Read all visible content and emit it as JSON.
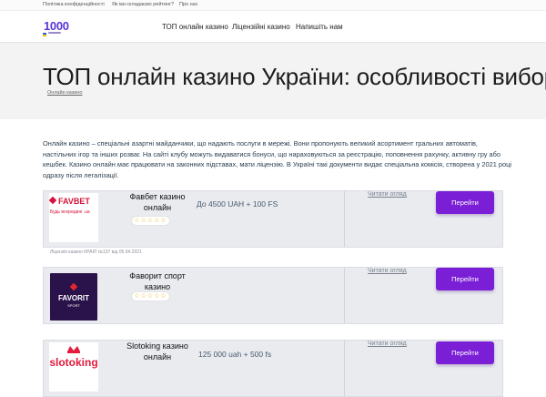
{
  "topbar": {
    "links": [
      "Політика конфіденційності",
      "Як ми складаємо рейтинг?",
      "Про нас"
    ]
  },
  "header": {
    "logo_text": "1000",
    "nav": [
      "ТОП онлайн казино",
      "Ліцензійні казино",
      "Напишіть нам"
    ]
  },
  "hero": {
    "title": "ТОП онлайн казино України: особливості вибору",
    "breadcrumb": "Онлайн казино"
  },
  "intro": {
    "text": "Онлайн казино – спеціальні азартні майданчики, що надають послуги в мережі. Вони пропонують великий асортимент гральних автоматів, настільних ігор та інших розваг. На сайті клубу можуть видаватися бонуси, що нараховуються за реєстрацію, поповнення рахунку, активну гру або кешбек. Казино онлайн має працювати на законних підставах, мати ліцензію. В Україні такі документи видає спеціальна комісія, створена у 2021 році одразу після легалізації."
  },
  "casinos": [
    {
      "name": "Фавбет казино онлайн",
      "logo_text": "FAVBET",
      "logo_slogan": "Будь всередині .ua",
      "stars": "☆☆☆☆☆",
      "bonus": "До 4500 UAH + 100 FS",
      "review_label": "Читати огляд",
      "button_label": "Перейти",
      "license": "Ліцензія казино КРАІЛ №137 від 05.04.2021"
    },
    {
      "name": "Фаворит спорт казино",
      "logo_text": "FAVORIT",
      "logo_slogan": "SPORT",
      "stars": "☆☆☆☆☆",
      "bonus": "",
      "review_label": "Читати огляд",
      "button_label": "Перейти"
    },
    {
      "name": "Slotoking казино онлайн",
      "logo_text": "slotoking",
      "stars": "",
      "bonus": "125 000 uah + 500 fs",
      "review_label": "Читати огляд",
      "button_label": "Перейти"
    }
  ],
  "colors": {
    "accent": "#7b1fd6",
    "logo": "#5b35d5",
    "hero_bg": "#f3f3f4",
    "card_bg": "#e9ebef"
  }
}
